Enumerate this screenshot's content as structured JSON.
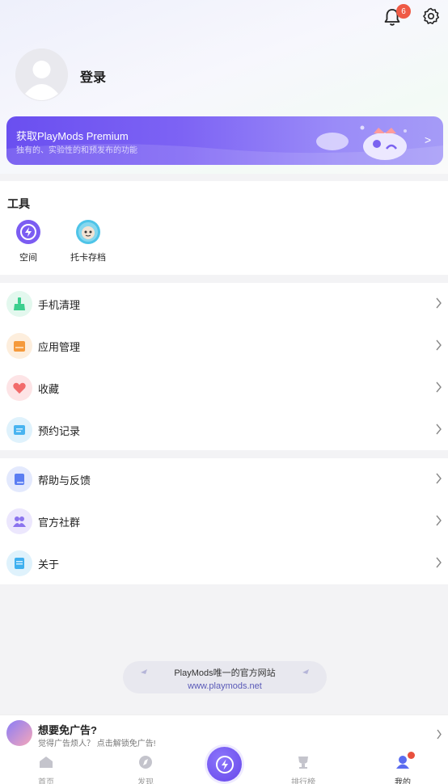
{
  "header": {
    "notification_count": "6"
  },
  "profile": {
    "login_label": "登录"
  },
  "premium": {
    "title": "获取PlayMods Premium",
    "subtitle": "独有的、实验性的和预发布的功能",
    "arrow": ">"
  },
  "tools": {
    "title": "工具",
    "items": [
      {
        "label": "空间",
        "icon": "space-icon"
      },
      {
        "label": "托卡存档",
        "icon": "toca-save-icon"
      }
    ]
  },
  "menu_group1": [
    {
      "label": "手机清理",
      "icon": "broom-icon",
      "color": "#3ccf8e"
    },
    {
      "label": "应用管理",
      "icon": "app-manage-icon",
      "color": "#f59a3c"
    },
    {
      "label": "收藏",
      "icon": "heart-icon",
      "color": "#f26b6b"
    },
    {
      "label": "预约记录",
      "icon": "reservation-icon",
      "color": "#49b4f0"
    }
  ],
  "menu_group2": [
    {
      "label": "帮助与反馈",
      "icon": "help-icon",
      "color": "#5b7ef2"
    },
    {
      "label": "官方社群",
      "icon": "community-icon",
      "color": "#8b74ee"
    },
    {
      "label": "关于",
      "icon": "about-icon",
      "color": "#3fb0ef"
    }
  ],
  "official_site": {
    "line1": "PlayMods唯一的官方网站",
    "line2": "www.playmods.net"
  },
  "ad_bar": {
    "title": "想要免广告?",
    "subtitle": "觉得广告烦人？ 点击解锁免广告!"
  },
  "tabbar": {
    "tabs": [
      {
        "label": "首页"
      },
      {
        "label": "发现"
      },
      {
        "label": "排行榜"
      },
      {
        "label": "我的"
      }
    ]
  },
  "colors": {
    "accent": "#6a4ff0",
    "badge": "#ef5a45"
  }
}
